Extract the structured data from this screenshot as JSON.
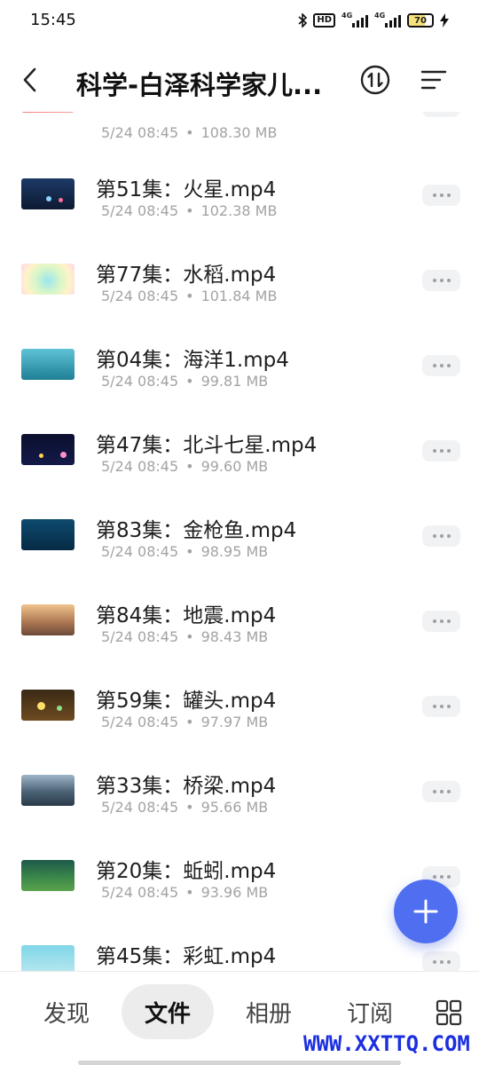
{
  "status_bar": {
    "time": "15:45",
    "hd_label": "HD",
    "net_1": "4G",
    "net_2": "4G",
    "battery": "70"
  },
  "header": {
    "title": "科学-白泽科学家儿..."
  },
  "partial_row": {
    "date": "5/24 08:45",
    "size": "108.30 MB"
  },
  "files": [
    {
      "name": "第51集：火星.mp4",
      "date": "5/24 08:45",
      "size": "102.38 MB"
    },
    {
      "name": "第77集：水稻.mp4",
      "date": "5/24 08:45",
      "size": "101.84 MB"
    },
    {
      "name": "第04集：海洋1.mp4",
      "date": "5/24 08:45",
      "size": "99.81 MB"
    },
    {
      "name": "第47集：北斗七星.mp4",
      "date": "5/24 08:45",
      "size": "99.60 MB"
    },
    {
      "name": "第83集：金枪鱼.mp4",
      "date": "5/24 08:45",
      "size": "98.95 MB"
    },
    {
      "name": "第84集：地震.mp4",
      "date": "5/24 08:45",
      "size": "98.43 MB"
    },
    {
      "name": "第59集：罐头.mp4",
      "date": "5/24 08:45",
      "size": "97.97 MB"
    },
    {
      "name": "第33集：桥梁.mp4",
      "date": "5/24 08:45",
      "size": "95.66 MB"
    },
    {
      "name": "第20集：蚯蚓.mp4",
      "date": "5/24 08:45",
      "size": "93.96 MB"
    },
    {
      "name": "第45集：彩虹.mp4",
      "date": "",
      "size": ""
    }
  ],
  "bottom_nav": {
    "tabs": [
      "发现",
      "文件",
      "相册",
      "订阅"
    ],
    "active": "文件"
  },
  "watermark": "WWW.XXTTQ.COM",
  "colors": {
    "accent": "#4f6ff0",
    "watermark": "#1c2fe0",
    "meta_text": "#a3a3a3"
  },
  "icons": [
    "bluetooth-icon",
    "back-arrow-icon",
    "sort-icon",
    "menu-icon",
    "more-icon",
    "plus-icon",
    "grid-icon"
  ]
}
